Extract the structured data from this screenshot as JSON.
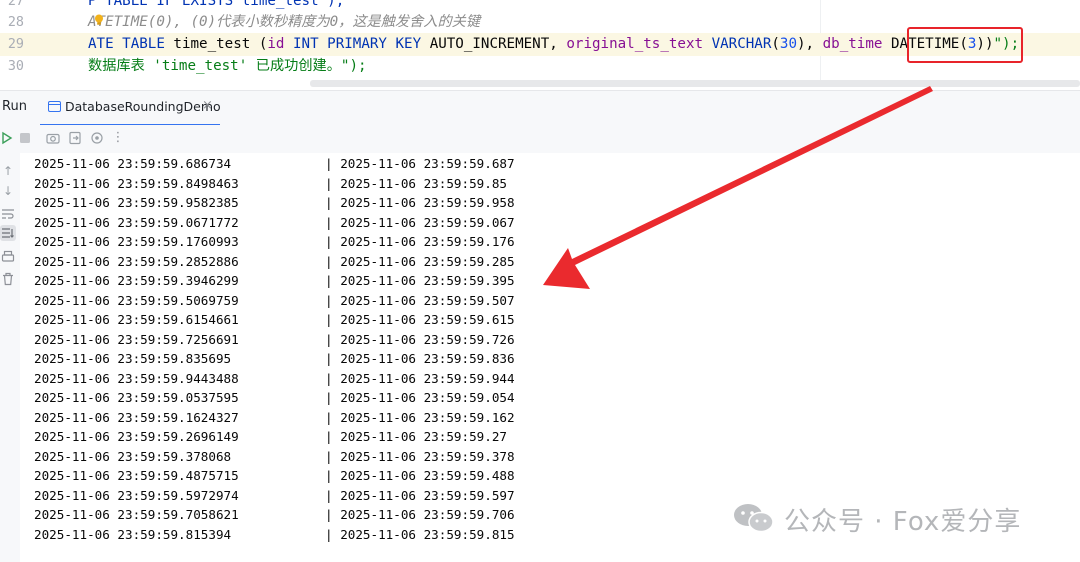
{
  "editor": {
    "lines": [
      {
        "number": "27",
        "segments": [
          {
            "t": "P TABLE IF EXISTS time_test\");",
            "c": "kw"
          }
        ]
      },
      {
        "number": "28",
        "segments": [
          {
            "t": "ATETIME(0), (0)代表小数秒精度为0，这是触发舍入的关键",
            "c": "cmt"
          }
        ]
      },
      {
        "number": "29",
        "segments": [
          {
            "t": "ATE TABLE ",
            "c": "kw"
          },
          {
            "t": "time_test ",
            "c": "plain"
          },
          {
            "t": "(",
            "c": "plain"
          },
          {
            "t": "id ",
            "c": "fld"
          },
          {
            "t": "INT PRIMARY KEY ",
            "c": "kw"
          },
          {
            "t": "AUTO_INCREMENT, ",
            "c": "plain"
          },
          {
            "t": "original_ts_text ",
            "c": "fld"
          },
          {
            "t": "VARCHAR",
            "c": "kw"
          },
          {
            "t": "(",
            "c": "plain"
          },
          {
            "t": "30",
            "c": "num"
          },
          {
            "t": "), ",
            "c": "plain"
          },
          {
            "t": "db_time ",
            "c": "fld"
          },
          {
            "t": "DATETIME",
            "c": "plain"
          },
          {
            "t": "(",
            "c": "plain"
          },
          {
            "t": "3",
            "c": "num"
          },
          {
            "t": "))",
            "c": "plain"
          },
          {
            "t": "\");",
            "c": "str"
          }
        ]
      },
      {
        "number": "30",
        "segments": [
          {
            "t": "数据库表 'time_test' 已成功创建。\");",
            "c": "str"
          }
        ]
      }
    ]
  },
  "run_panel": {
    "label": "Run",
    "tab_label": "DatabaseRoundingDemo",
    "tab_close": "×"
  },
  "console": {
    "rows": [
      {
        "left": "2025-11-06 23:59:59.686734",
        "right": "2025-11-06 23:59:59.687"
      },
      {
        "left": "2025-11-06 23:59:59.8498463",
        "right": "2025-11-06 23:59:59.85"
      },
      {
        "left": "2025-11-06 23:59:59.9582385",
        "right": "2025-11-06 23:59:59.958"
      },
      {
        "left": "2025-11-06 23:59:59.0671772",
        "right": "2025-11-06 23:59:59.067"
      },
      {
        "left": "2025-11-06 23:59:59.1760993",
        "right": "2025-11-06 23:59:59.176"
      },
      {
        "left": "2025-11-06 23:59:59.2852886",
        "right": "2025-11-06 23:59:59.285"
      },
      {
        "left": "2025-11-06 23:59:59.3946299",
        "right": "2025-11-06 23:59:59.395"
      },
      {
        "left": "2025-11-06 23:59:59.5069759",
        "right": "2025-11-06 23:59:59.507"
      },
      {
        "left": "2025-11-06 23:59:59.6154661",
        "right": "2025-11-06 23:59:59.615"
      },
      {
        "left": "2025-11-06 23:59:59.7256691",
        "right": "2025-11-06 23:59:59.726"
      },
      {
        "left": "2025-11-06 23:59:59.835695",
        "right": "2025-11-06 23:59:59.836"
      },
      {
        "left": "2025-11-06 23:59:59.9443488",
        "right": "2025-11-06 23:59:59.944"
      },
      {
        "left": "2025-11-06 23:59:59.0537595",
        "right": "2025-11-06 23:59:59.054"
      },
      {
        "left": "2025-11-06 23:59:59.1624327",
        "right": "2025-11-06 23:59:59.162"
      },
      {
        "left": "2025-11-06 23:59:59.2696149",
        "right": "2025-11-06 23:59:59.27"
      },
      {
        "left": "2025-11-06 23:59:59.378068",
        "right": "2025-11-06 23:59:59.378"
      },
      {
        "left": "2025-11-06 23:59:59.4875715",
        "right": "2025-11-06 23:59:59.488"
      },
      {
        "left": "2025-11-06 23:59:59.5972974",
        "right": "2025-11-06 23:59:59.597"
      },
      {
        "left": "2025-11-06 23:59:59.7058621",
        "right": "2025-11-06 23:59:59.706"
      },
      {
        "left": "2025-11-06 23:59:59.815394",
        "right": "2025-11-06 23:59:59.815"
      }
    ],
    "separator": "|"
  },
  "annotation": {
    "color": "#e8242a",
    "highlighted_text": "DATETIME(3)"
  },
  "watermark": {
    "text": "公众号 · Fox爱分享"
  },
  "colors": {
    "keyword": "#0033b3",
    "string": "#067d17",
    "field": "#871094",
    "number": "#1750eb",
    "comment": "#8c8c8c",
    "accent": "#3574f0"
  },
  "icons": {
    "toolbar": [
      "rerun-icon",
      "stop-icon",
      "camera-icon",
      "export-icon",
      "settings-icon",
      "more-icon"
    ],
    "gutter": [
      "up-arrow-icon",
      "down-arrow-icon",
      "soft-wrap-icon",
      "scroll-to-end-icon",
      "print-icon",
      "trash-icon"
    ]
  }
}
